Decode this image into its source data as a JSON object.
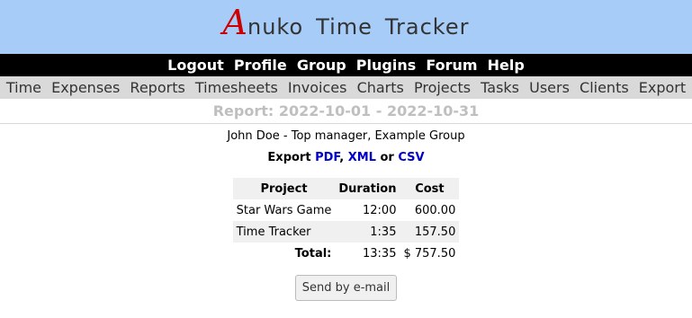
{
  "logo": {
    "first_letter": "A",
    "rest_word1": "nuko",
    "word2": "Time",
    "word3": "Tracker"
  },
  "top_nav": [
    "Logout",
    "Profile",
    "Group",
    "Plugins",
    "Forum",
    "Help"
  ],
  "main_nav": [
    "Time",
    "Expenses",
    "Reports",
    "Timesheets",
    "Invoices",
    "Charts",
    "Projects",
    "Tasks",
    "Users",
    "Clients",
    "Export"
  ],
  "page": {
    "title": "Report: 2022-10-01 - 2022-10-31",
    "user_line": "John Doe - Top manager, Example Group",
    "export": {
      "prefix": "Export",
      "pdf": "PDF",
      "comma": ",",
      "xml": "XML",
      "or": "or",
      "csv": "CSV"
    }
  },
  "report_table": {
    "headers": {
      "project": "Project",
      "duration": "Duration",
      "cost": "Cost"
    },
    "rows": [
      {
        "project": "Star Wars Game",
        "duration": "12:00",
        "cost": "600.00"
      },
      {
        "project": "Time Tracker",
        "duration": "1:35",
        "cost": "157.50"
      }
    ],
    "total": {
      "label": "Total:",
      "duration": "13:35",
      "cost": "$ 757.50"
    }
  },
  "send_button": "Send by e-mail",
  "colors": {
    "banner": "#a6ccf7",
    "logo_a": "#cc0000",
    "link": "#0000cc",
    "title": "#bfbfbf"
  }
}
